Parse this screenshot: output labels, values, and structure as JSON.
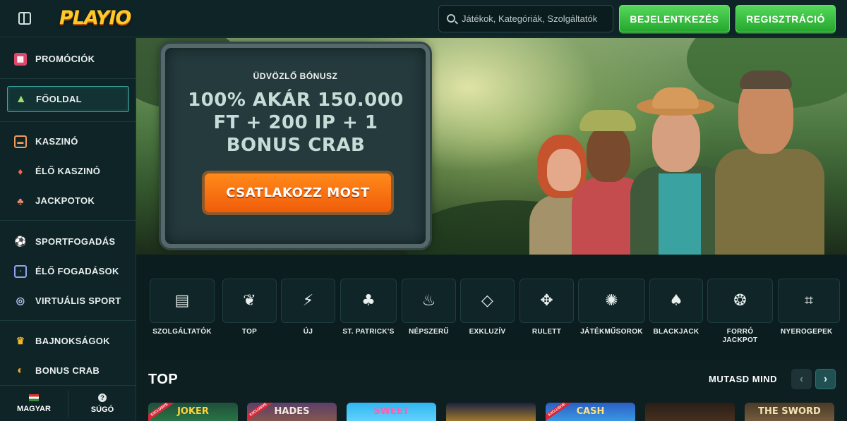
{
  "header": {
    "menu_icon": "sidebar-toggle-icon",
    "logo": "PLAYIO",
    "search_placeholder": "Játékok, Kategóriák, Szolgáltatók",
    "login_label": "BEJELENTKEZÉS",
    "register_label": "REGISZTRÁCIÓ"
  },
  "sidebar": {
    "items": [
      {
        "label": "PROMÓCIÓK",
        "icon": "gift-icon"
      },
      {
        "label": "FŐOLDAL",
        "icon": "tent-icon"
      },
      {
        "label": "KASZINÓ",
        "icon": "slot-machine-icon"
      },
      {
        "label": "ÉLŐ KASZINÓ",
        "icon": "cards-icon"
      },
      {
        "label": "JACKPOTOK",
        "icon": "clover-icon"
      },
      {
        "label": "SPORTFOGADÁS",
        "icon": "soccer-ball-icon"
      },
      {
        "label": "ÉLŐ FOGADÁSOK",
        "icon": "live-tv-icon"
      },
      {
        "label": "VIRTUÁLIS SPORT",
        "icon": "gamepad-icon"
      },
      {
        "label": "BAJNOKSÁGOK",
        "icon": "trophy-icon"
      },
      {
        "label": "BONUS CRAB",
        "icon": "claw-icon"
      }
    ],
    "language_label": "MAGYAR",
    "help_label": "SÚGÓ"
  },
  "banner": {
    "label": "ÜDVÖZLŐ BÓNUSZ",
    "title": "100% AKÁR 150.000 FT + 200 IP + 1 BONUS CRAB",
    "cta_label": "CSATLAKOZZ MOST"
  },
  "categories": [
    {
      "label": "SZOLGÁLTATÓK",
      "icon": "provider-icon"
    },
    {
      "label": "TOP",
      "icon": "lotus-icon"
    },
    {
      "label": "ÚJ",
      "icon": "lightning-icon"
    },
    {
      "label": "ST. PATRICK'S",
      "icon": "leprechaun-hat-icon"
    },
    {
      "label": "NÉPSZERŰ",
      "icon": "fire-icon"
    },
    {
      "label": "EXKLUZÍV",
      "icon": "diamond-icon"
    },
    {
      "label": "RULETT",
      "icon": "roulette-icon"
    },
    {
      "label": "JÁTÉKMŰSOROK",
      "icon": "wheel-icon"
    },
    {
      "label": "BLACKJACK",
      "icon": "spade-icon"
    },
    {
      "label": "FORRÓ JACKPOT",
      "icon": "hot-jackpot-icon"
    },
    {
      "label": "NYERŐGÉPEK",
      "icon": "slot-777-icon"
    }
  ],
  "top_section": {
    "title": "TOP",
    "see_all_label": "MUTASD MIND",
    "prev_icon": "chevron-left-icon",
    "next_icon": "chevron-right-icon",
    "games": [
      {
        "title": "JOKER",
        "badge": "EXCLUSIVE"
      },
      {
        "title": "HADES",
        "badge": "EXCLUSIVE"
      },
      {
        "title": "SWEET",
        "badge": ""
      },
      {
        "title": "",
        "badge": ""
      },
      {
        "title": "CASH",
        "badge": "EXCLUSIVE"
      },
      {
        "title": "",
        "badge": ""
      },
      {
        "title": "THE SWORD",
        "badge": ""
      }
    ]
  },
  "colors": {
    "accent_green": "#2fb537",
    "cta_orange": "#f26c10",
    "logo_yellow": "#ffc928",
    "background": "#0d1f21"
  }
}
